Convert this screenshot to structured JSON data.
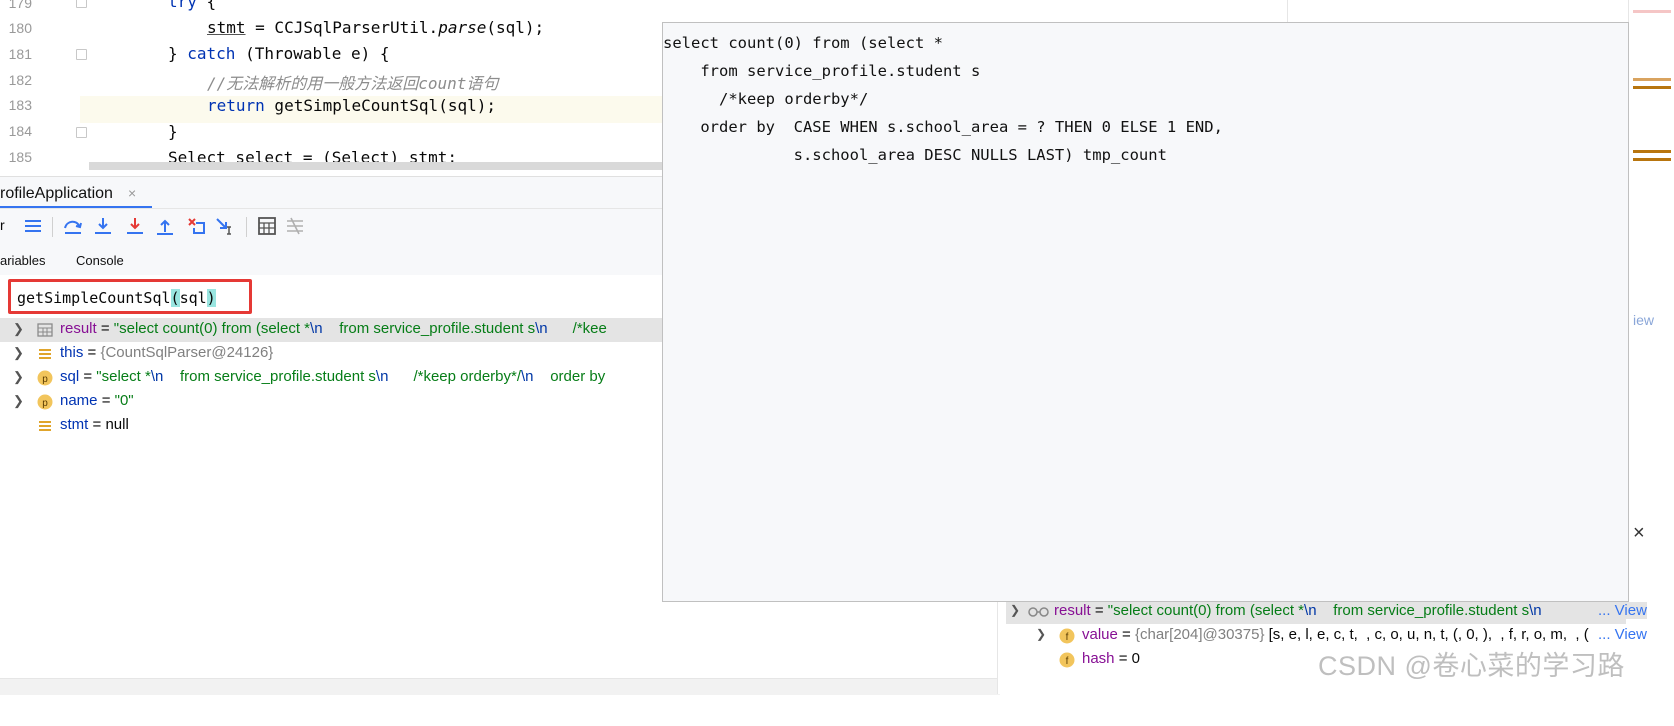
{
  "editor": {
    "line_numbers": [
      "179",
      "180",
      "181",
      "182",
      "183",
      "184",
      "185"
    ],
    "lines": {
      "l179_kw": "try",
      "l179_rest": " {",
      "l180_a": "stmt",
      "l180_b": " = CCJSqlParserUtil.",
      "l180_c": "parse",
      "l180_d": "(sql);",
      "l181_a": "} ",
      "l181_kw": "catch",
      "l181_b": " (Throwable e) {",
      "l182_comment": "//无法解析的用一般方法返回count语句",
      "l183_kw": "return",
      "l183_rest": " getSimpleCountSql(sql);",
      "l184": "}",
      "l185_a": "Select select = (Select) ",
      "l185_b": "stmt",
      "l185_c": ";"
    }
  },
  "debug": {
    "tab_title": "rofileApplication",
    "tab_close": "×",
    "toolbar_partial_label": "r",
    "subtabs": {
      "variables": "ariables",
      "console": "Console"
    },
    "eval_expression": {
      "a": "getSimpleCountSql",
      "b": "(",
      "c": "sql",
      "d": ")"
    },
    "variables": [
      {
        "name": "result",
        "eq": " = ",
        "value": "\"select count(0) from (select *",
        "esc1": "\\n",
        "mid": "    from service_profile.student s",
        "esc2": "\\n",
        "tail": "      /*kee"
      },
      {
        "name": "this",
        "eq": " = ",
        "value": "{CountSqlParser@24126}"
      },
      {
        "name": "sql",
        "eq": " = ",
        "value": "\"select *",
        "esc1": "\\n",
        "mid": "    from service_profile.student s",
        "esc2": "\\n",
        "tail": "      /*keep orderby*/",
        "esc3": "\\n",
        "tail2": "    order by"
      },
      {
        "name": "name",
        "eq": " = ",
        "value": "\"0\""
      },
      {
        "name": "stmt",
        "eq": " = ",
        "value": "null"
      }
    ]
  },
  "popup": {
    "sql_lines": [
      "select count(0) from (select *",
      "    from service_profile.student s",
      "      /*keep orderby*/",
      "    order by  CASE WHEN s.school_area = ? THEN 0 ELSE 1 END,",
      "              s.school_area DESC NULLS LAST) tmp_count"
    ]
  },
  "right_debug": {
    "close": "×",
    "result_name": "result",
    "result_eq": " = ",
    "result_value": "\"select count(0) from (select *",
    "result_esc": "\\n",
    "result_mid": "    from service_profile.student s",
    "result_esc2": "\\n",
    "result_view": "... View",
    "value_name": "value",
    "value_eq": " = ",
    "value_type": "{char[204]@30375}",
    "value_chars": " [s, e, l, e, c, t,  , c, o, u, n, t, (, 0, ),  , f, r, o, m,  , (",
    "value_view": "... View",
    "hash_name": "hash",
    "hash_eq": " = ",
    "hash_value": "0",
    "view_partial": "iew"
  },
  "watermark": "CSDN @卷心菜的学习路",
  "colors": {
    "accent": "#3574f0",
    "highlight_box": "#e53935",
    "string": "#067d17",
    "keyword": "#0033b3"
  }
}
